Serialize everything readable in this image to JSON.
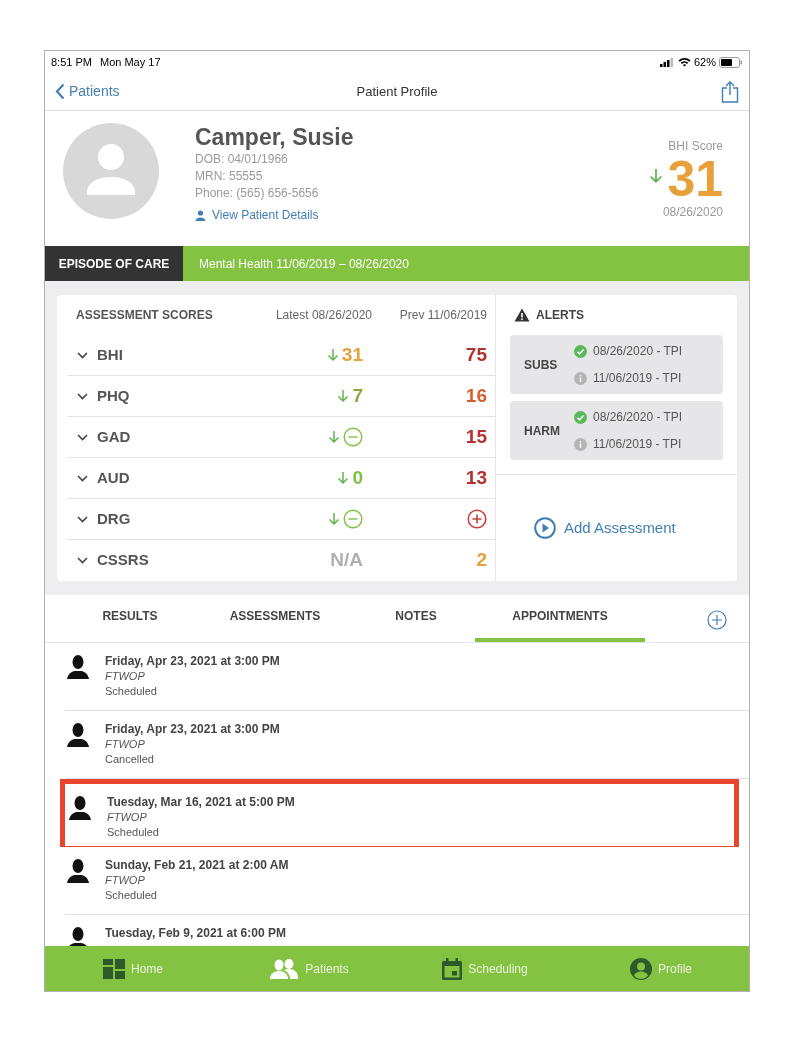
{
  "status_bar": {
    "time": "8:51 PM",
    "date": "Mon May 17",
    "battery": "62%"
  },
  "nav": {
    "back": "Patients",
    "title": "Patient Profile"
  },
  "patient": {
    "name": "Camper, Susie",
    "dob": "DOB: 04/01/1966",
    "mrn": "MRN: 55555",
    "phone": "Phone: (565) 656-5656",
    "details_link": "View Patient Details"
  },
  "bhi_score": {
    "label": "BHI Score",
    "value": "31",
    "trend_down": true,
    "color": "#e8a13a",
    "date": "08/26/2020"
  },
  "episode": {
    "label": "EPISODE OF CARE",
    "value": "Mental Health 11/06/2019 – 08/26/2020"
  },
  "scores": {
    "columns": [
      "ASSESSMENT SCORES",
      "Latest 08/26/2020",
      "Prev 11/06/2019"
    ],
    "rows": [
      {
        "name": "BHI",
        "expanded": false,
        "latest": {
          "kind": "number",
          "text": "31",
          "trend_down": true,
          "color": "#e8a13a"
        },
        "prev": {
          "kind": "number",
          "text": "75",
          "color": "#b3312c"
        }
      },
      {
        "name": "PHQ",
        "expanded": false,
        "latest": {
          "kind": "number",
          "text": "7",
          "trend_down": true,
          "color": "#93a83c"
        },
        "prev": {
          "kind": "number",
          "text": "16",
          "color": "#d5602d"
        }
      },
      {
        "name": "GAD",
        "expanded": false,
        "latest": {
          "kind": "minus",
          "trend_down": true,
          "color": "#7dc142"
        },
        "prev": {
          "kind": "number",
          "text": "15",
          "color": "#b8322c"
        }
      },
      {
        "name": "AUD",
        "expanded": false,
        "latest": {
          "kind": "number",
          "text": "0",
          "trend_down": true,
          "color": "#7dc142"
        },
        "prev": {
          "kind": "number",
          "text": "13",
          "color": "#b3312c"
        }
      },
      {
        "name": "DRG",
        "expanded": false,
        "latest": {
          "kind": "minus",
          "trend_down": true,
          "color": "#7dc142"
        },
        "prev": {
          "kind": "plus",
          "color": "#c8403a"
        }
      },
      {
        "name": "CSSRS",
        "expanded": false,
        "latest": {
          "kind": "number",
          "text": "N/A",
          "trend_down": false,
          "color": "#b0b0b0"
        },
        "prev": {
          "kind": "number",
          "text": "2",
          "color": "#e8a13a"
        }
      }
    ]
  },
  "alerts": {
    "title": "ALERTS",
    "groups": [
      {
        "label": "SUBS",
        "entries": [
          {
            "kind": "check",
            "text": "08/26/2020 - TPI"
          },
          {
            "kind": "info",
            "text": "11/06/2019 - TPI"
          }
        ]
      },
      {
        "label": "HARM",
        "entries": [
          {
            "kind": "check",
            "text": "08/26/2020 - TPI"
          },
          {
            "kind": "info",
            "text": "11/06/2019 - TPI"
          }
        ]
      }
    ],
    "add_button": "Add Assessment"
  },
  "tabs": [
    {
      "label": "RESULTS",
      "selected": false
    },
    {
      "label": "ASSESSMENTS",
      "selected": false
    },
    {
      "label": "NOTES",
      "selected": false
    },
    {
      "label": "APPOINTMENTS",
      "selected": true
    }
  ],
  "appointments": [
    {
      "datetime": "Friday, Apr 23, 2021 at 3:00 PM",
      "type": "FTWOP",
      "status": "Scheduled",
      "highlighted": false
    },
    {
      "datetime": "Friday, Apr 23, 2021 at 3:00 PM",
      "type": "FTWOP",
      "status": "Cancelled",
      "highlighted": false
    },
    {
      "datetime": "Tuesday, Mar 16, 2021 at 5:00 PM",
      "type": "FTWOP",
      "status": "Scheduled",
      "highlighted": true
    },
    {
      "datetime": "Sunday, Feb 21, 2021 at 2:00 AM",
      "type": "FTWOP",
      "status": "Scheduled",
      "highlighted": false
    },
    {
      "datetime": "Tuesday, Feb 9, 2021 at 6:00 PM",
      "highlighted": false
    }
  ],
  "tab_bar": [
    {
      "kind": "home",
      "label": "Home"
    },
    {
      "kind": "patients",
      "label": "Patients"
    },
    {
      "kind": "scheduling",
      "label": "Scheduling"
    },
    {
      "kind": "profile",
      "label": "Profile"
    }
  ]
}
